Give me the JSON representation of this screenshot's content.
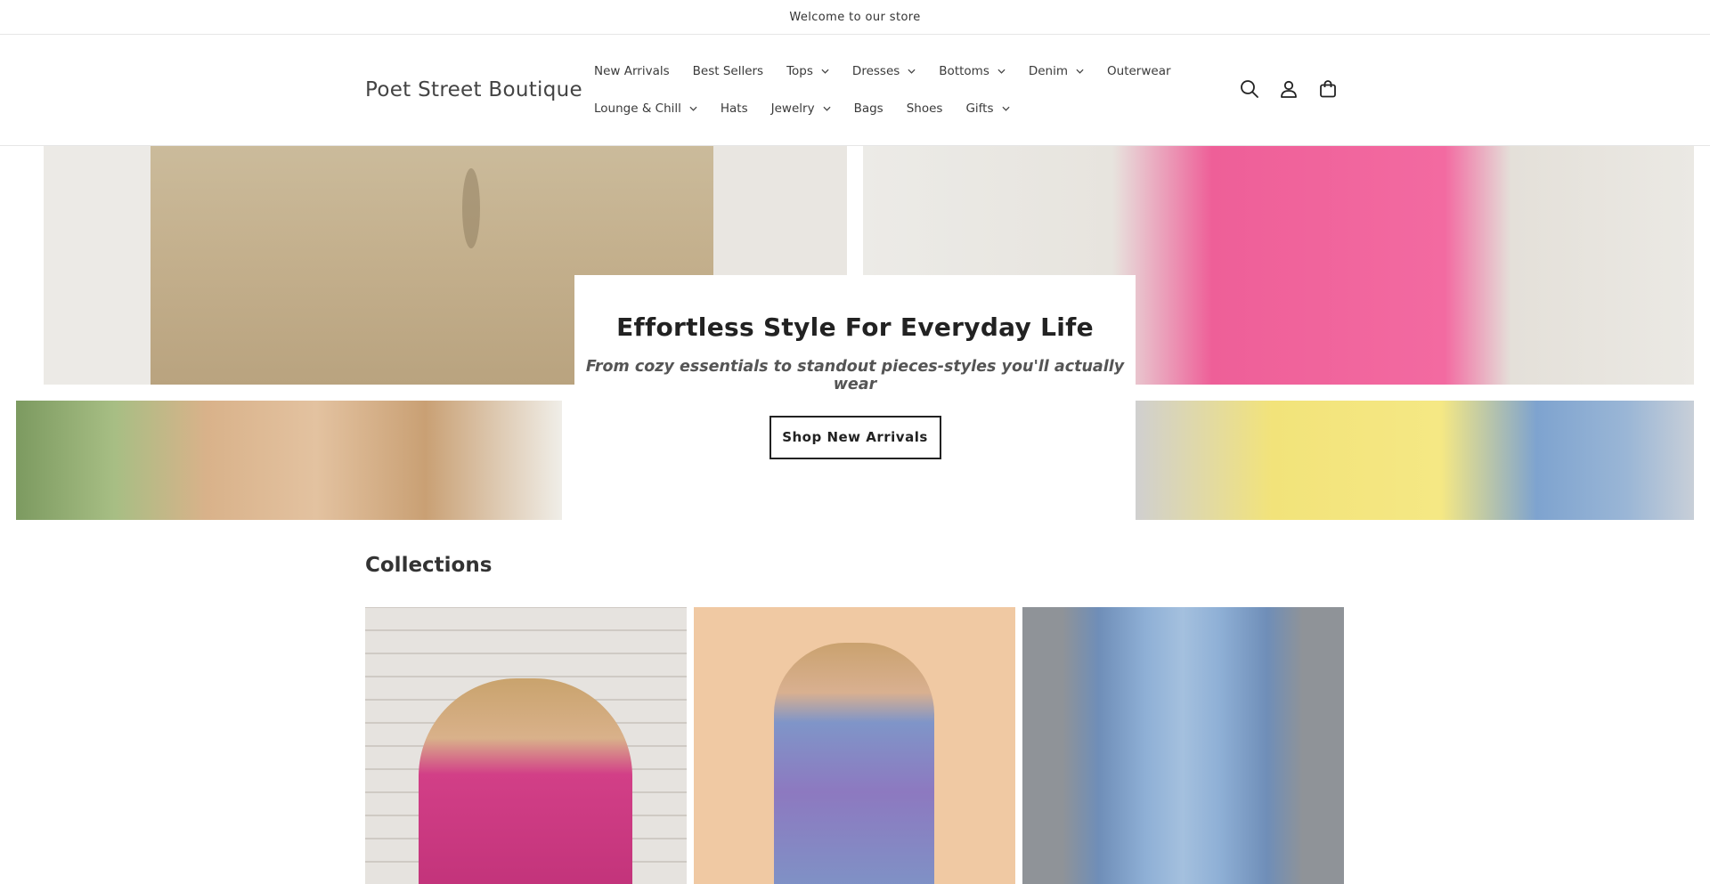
{
  "announcement": {
    "text": "Welcome to our store"
  },
  "header": {
    "logo": "Poet Street Boutique",
    "nav_row1": [
      {
        "label": "New Arrivals",
        "dropdown": false
      },
      {
        "label": "Best Sellers",
        "dropdown": false
      },
      {
        "label": "Tops",
        "dropdown": true
      },
      {
        "label": "Dresses",
        "dropdown": true
      },
      {
        "label": "Bottoms",
        "dropdown": true
      },
      {
        "label": "Denim",
        "dropdown": true
      },
      {
        "label": "Outerwear",
        "dropdown": false
      }
    ],
    "nav_row2": [
      {
        "label": "Lounge & Chill",
        "dropdown": true
      },
      {
        "label": "Hats",
        "dropdown": false
      },
      {
        "label": "Jewelry",
        "dropdown": true
      },
      {
        "label": "Bags",
        "dropdown": false
      },
      {
        "label": "Shoes",
        "dropdown": false
      },
      {
        "label": "Gifts",
        "dropdown": true
      }
    ],
    "icons": [
      "search-icon",
      "account-icon",
      "cart-icon"
    ]
  },
  "hero": {
    "title": "Effortless Style For Everyday Life",
    "subtitle": "From cozy essentials to standout pieces-styles you'll actually wear",
    "button_label": "Shop New Arrivals"
  },
  "collections": {
    "title": "Collections"
  }
}
